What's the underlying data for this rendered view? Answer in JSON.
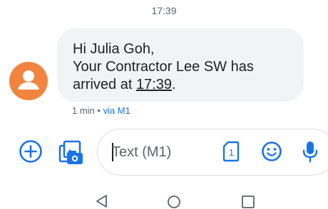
{
  "status": {
    "timestamp": "17:39"
  },
  "message": {
    "line1": "Hi Julia Goh,",
    "line2": "Your Contractor Lee SW has",
    "line3_prefix": "arrived at ",
    "line3_time": "17:39",
    "line3_suffix": ".",
    "meta_age": "1 min",
    "meta_sep": " • ",
    "meta_via": "via M1"
  },
  "compose": {
    "placeholder": "Text (M1)",
    "value": "",
    "sim_number": "1"
  },
  "icons": {
    "add": "add-circle-icon",
    "gallery": "photo-gallery-icon",
    "sim": "sim-card-icon",
    "emoji": "emoji-icon",
    "mic": "microphone-icon",
    "back": "nav-back-icon",
    "home": "nav-home-icon",
    "recents": "nav-recents-icon"
  },
  "colors": {
    "accent": "#1a73e8",
    "avatar": "#f1843e",
    "bubble": "#f1f3f4"
  }
}
